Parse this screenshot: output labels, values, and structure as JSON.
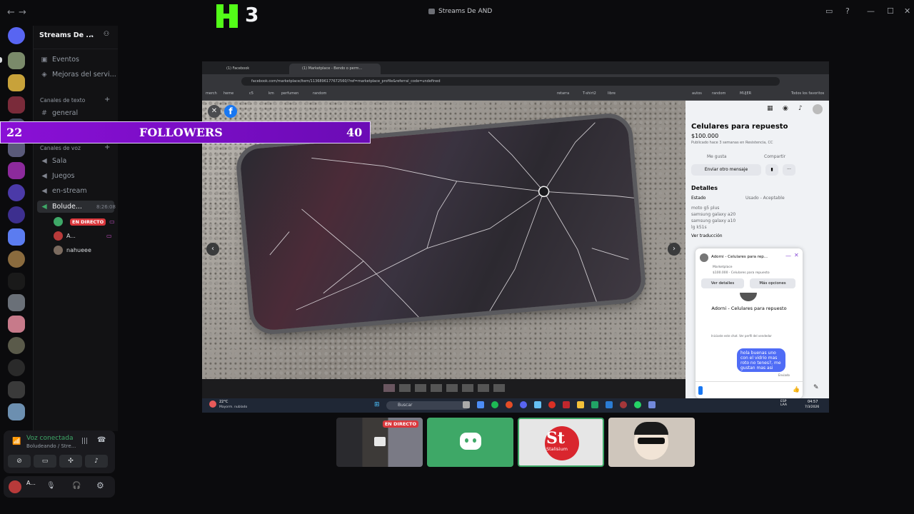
{
  "window": {
    "title": "Streams De AND",
    "back": "←",
    "forward": "→",
    "controls": [
      "▭",
      "?",
      "—",
      "☐",
      "✕"
    ]
  },
  "kick": {
    "count": "3"
  },
  "server": {
    "name": "Streams De ..."
  },
  "menu": [
    {
      "label": "Eventos"
    },
    {
      "label": "Mejoras del servi..."
    }
  ],
  "text_category": "Canales de texto",
  "text_channels": [
    {
      "label": "general"
    }
  ],
  "voice_category": "Canales de voz",
  "voice_channels": [
    {
      "label": "Sala"
    },
    {
      "label": "Juegos"
    },
    {
      "label": "en-stream"
    },
    {
      "label": "Bolude...",
      "timer": "8:26:08"
    }
  ],
  "voice_users": [
    {
      "name": "",
      "badge": "EN DIRECTO"
    },
    {
      "name": "A..."
    },
    {
      "name": "nahueee"
    }
  ],
  "voice_panel": {
    "status": "Voz conectada",
    "channel": "Boludeando / Stre..."
  },
  "user_panel": {
    "name": "A..."
  },
  "followers": {
    "left": "22",
    "label": "FOLLOWERS",
    "right": "40"
  },
  "browser": {
    "tabs": [
      "(1) Facebook",
      "(1) Marketplace - Bendo o perm..."
    ],
    "url": "facebook.com/marketplace/item/1136896177672560/?ref=marketplace_profile&referral_code=undefined",
    "bookmarks": [
      "merch",
      "heme",
      "c5",
      "km",
      "perfumen",
      "random",
      "retarra",
      "T-shirt2",
      "libre",
      "autos",
      "random",
      "MUJER",
      "Todos los favoritos"
    ],
    "taskbar_search": "Buscar",
    "weather": "22°C",
    "weather_sub": "Mayorm. nublado",
    "tray_lang": "ESP\nLAA",
    "tray_time": "04:57",
    "tray_date": "7/3/2026"
  },
  "listing": {
    "title": "Celulares para repuesto",
    "price": "$100.000",
    "posted": "Publicado hace 3 semanas en Resistencia, CC",
    "actions": [
      "Me gusta",
      "Compartir"
    ],
    "send_button": "Enviar otro mensaje",
    "details_heading": "Detalles",
    "state_label": "Estado",
    "state_value": "Usado - Aceptable",
    "description": [
      "moto g5 plus",
      "samsung galaxy a20",
      "samsung galaxy a10",
      "lg k51s"
    ],
    "translate": "Ver traducción"
  },
  "chat": {
    "header": "Adorni - Celulares para rep...",
    "sub1": "Marketplace",
    "sub2": "$100.000 · Celulares para repuesto",
    "btn_details": "Ver detalles",
    "btn_more": "Más opciones",
    "name": "Adorni - Celulares para repuesto",
    "note": "Iniciaste este chat. Ver perfil del vendedor",
    "message": "hola buenas uno con el vidrio mas roto no tenes?, me gustan mas asi",
    "seen": "Enviado"
  },
  "tiles": [
    {
      "badge": "EN DIRECTO"
    },
    {
      "label": "St",
      "sub": "Stalisium"
    }
  ]
}
